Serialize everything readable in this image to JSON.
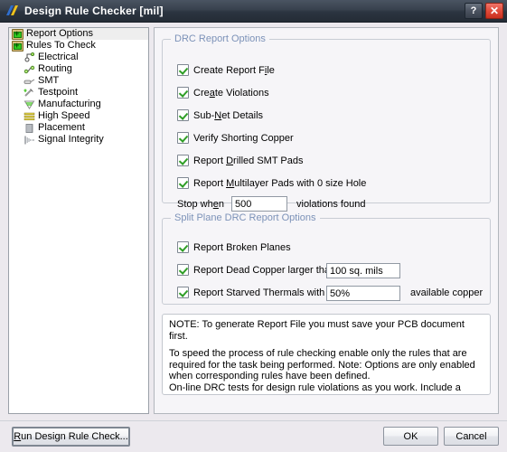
{
  "window": {
    "title": "Design Rule Checker [mil]",
    "icon": "altium-logo-icon",
    "help_label": "?",
    "close_label": "✕"
  },
  "tree": {
    "nodes": [
      {
        "label": "Report Options",
        "icon": "folder-icon",
        "level": 0,
        "selected": true
      },
      {
        "label": "Rules To Check",
        "icon": "folder-icon",
        "level": 0,
        "selected": false
      },
      {
        "label": "Electrical",
        "icon": "electrical-icon",
        "level": 1,
        "selected": false
      },
      {
        "label": "Routing",
        "icon": "routing-icon",
        "level": 1,
        "selected": false
      },
      {
        "label": "SMT",
        "icon": "smt-icon",
        "level": 1,
        "selected": false
      },
      {
        "label": "Testpoint",
        "icon": "testpoint-icon",
        "level": 1,
        "selected": false
      },
      {
        "label": "Manufacturing",
        "icon": "manufacturing-icon",
        "level": 1,
        "selected": false
      },
      {
        "label": "High Speed",
        "icon": "high-speed-icon",
        "level": 1,
        "selected": false
      },
      {
        "label": "Placement",
        "icon": "placement-icon",
        "level": 1,
        "selected": false
      },
      {
        "label": "Signal Integrity",
        "icon": "signal-integrity-icon",
        "level": 1,
        "selected": false
      }
    ]
  },
  "drc_group": {
    "legend": "DRC Report Options",
    "options": [
      {
        "label_pre": "Create Report F",
        "mnemonic": "i",
        "label_post": "le",
        "checked": true
      },
      {
        "label_pre": "Cre",
        "mnemonic": "a",
        "label_post": "te Violations",
        "checked": true
      },
      {
        "label_pre": "Sub-",
        "mnemonic": "N",
        "label_post": "et Details",
        "checked": true
      },
      {
        "label_pre": "Verify Shorting Copper",
        "mnemonic": "",
        "label_post": "",
        "checked": true
      },
      {
        "label_pre": "Report ",
        "mnemonic": "D",
        "label_post": "rilled SMT Pads",
        "checked": true
      },
      {
        "label_pre": "Report ",
        "mnemonic": "M",
        "label_post": "ultilayer Pads with 0 size Hole",
        "checked": true
      }
    ],
    "stop_when": {
      "label_pre": "Stop wh",
      "mnemonic": "e",
      "label_post": "n",
      "value": "500",
      "suffix": "violations found"
    }
  },
  "split_group": {
    "legend": "Split Plane DRC Report Options",
    "broken_planes": {
      "label": "Report Broken Planes",
      "checked": true
    },
    "dead_copper": {
      "label": "Report Dead Copper larger than",
      "checked": true,
      "value": "100 sq. mils",
      "suffix": ""
    },
    "starved_thermals": {
      "label": "Report Starved Thermals with less than",
      "checked": true,
      "value": "50%",
      "suffix": "available copper"
    }
  },
  "note": {
    "line1": "NOTE: To generate Report File you must save your PCB document first.",
    "line2": "To speed the process of rule checking enable only the rules that are required for the task being performed.  Note: Options are only enabled when corresponding rules have been defined.",
    "line3": "On-line DRC tests for design rule violations as you work. Include a Design Rule in the Design-Rules dialog to be able to test for a particular rule  type."
  },
  "footer": {
    "run_pre": "R",
    "run_mnemonic": "R",
    "run_label": "un Design Rule Check...",
    "ok_label": "OK",
    "cancel_label": "Cancel"
  },
  "colors": {
    "titlebar": "#2b3440",
    "close_button": "#e04b3a",
    "legend_text": "#7c92b8",
    "check_green": "#2f9e26",
    "panel_bg": "#f6f5f8",
    "dialog_bg": "#ece9ee"
  }
}
